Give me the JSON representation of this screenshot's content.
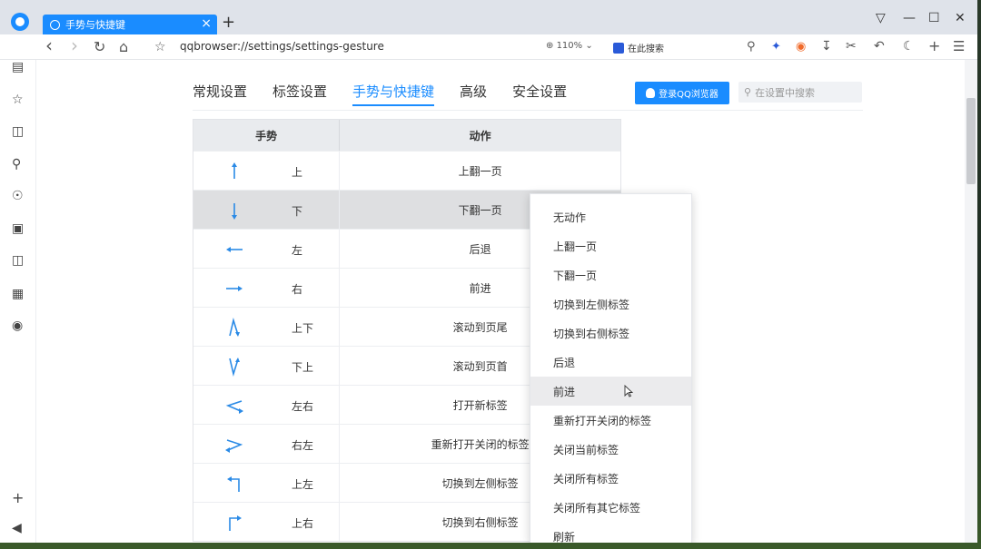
{
  "tab": {
    "title": "手势与快捷键",
    "close": "×",
    "new_tab": "+"
  },
  "window_controls": {
    "restore": "⌂",
    "minimize": "—",
    "maximize": "☐",
    "close": "✕"
  },
  "toolbar": {
    "back": "‹",
    "forward": "›",
    "reload": "↻",
    "home": "⌂",
    "star": "☆",
    "address": "qqbrowser://settings/settings-gesture",
    "zoom": "110%",
    "search_engine_placeholder": "在此搜索"
  },
  "settings": {
    "nav": [
      "常规设置",
      "标签设置",
      "手势与快捷键",
      "高级",
      "安全设置"
    ],
    "active_nav": "手势与快捷键",
    "login_button": "登录QQ浏览器",
    "search_placeholder": "在设置中搜索"
  },
  "gesture_table": {
    "headers": [
      "手势",
      "动作"
    ],
    "rows": [
      {
        "gesture": "上",
        "action": "上翻一页",
        "icon": "arrow-up-icon"
      },
      {
        "gesture": "下",
        "action": "下翻一页",
        "icon": "arrow-down-icon"
      },
      {
        "gesture": "左",
        "action": "后退",
        "icon": "arrow-left-icon"
      },
      {
        "gesture": "右",
        "action": "前进",
        "icon": "arrow-right-icon"
      },
      {
        "gesture": "上下",
        "action": "滚动到页尾",
        "icon": "up-down-icon"
      },
      {
        "gesture": "下上",
        "action": "滚动到页首",
        "icon": "down-up-icon"
      },
      {
        "gesture": "左右",
        "action": "打开新标签",
        "icon": "left-right-icon"
      },
      {
        "gesture": "右左",
        "action": "重新打开关闭的标签",
        "icon": "right-left-icon"
      },
      {
        "gesture": "上左",
        "action": "切换到左侧标签",
        "icon": "up-left-icon"
      },
      {
        "gesture": "上右",
        "action": "切换到右侧标签",
        "icon": "up-right-icon"
      }
    ],
    "selected_row": 1
  },
  "dropdown": {
    "items": [
      "无动作",
      "上翻一页",
      "下翻一页",
      "切换到左侧标签",
      "切换到右侧标签",
      "后退",
      "前进",
      "重新打开关闭的标签",
      "关闭当前标签",
      "关闭所有标签",
      "关闭所有其它标签",
      "刷新"
    ],
    "hovered": 6
  },
  "colors": {
    "accent": "#1a8cff",
    "selected_row": "#dedfe1"
  }
}
